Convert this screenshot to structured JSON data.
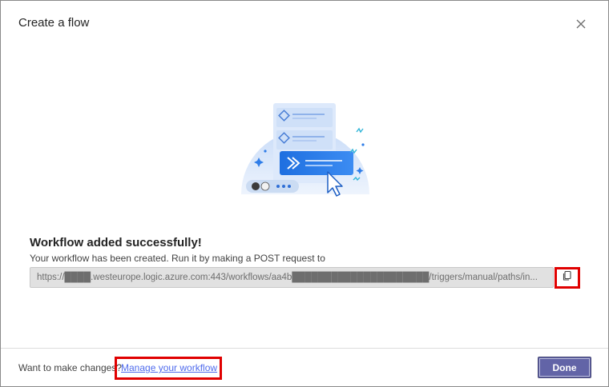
{
  "dialog": {
    "title": "Create a flow",
    "close_icon": "close-icon"
  },
  "content": {
    "illustration_icon": "workflow-illustration",
    "heading": "Workflow added successfully!",
    "description": "Your workflow has been created. Run it by making a POST request to",
    "url": "https://████.westeurope.logic.azure.com:443/workflows/aa4b█████████████████████/triggers/manual/paths/in...",
    "copy_icon": "copy-icon"
  },
  "footer": {
    "prompt": "Want to make changes?",
    "manage_link": "Manage your workflow",
    "done_label": "Done"
  },
  "colors": {
    "accent": "#6264a7",
    "link": "#4f6bed",
    "highlight": "#e00000"
  }
}
